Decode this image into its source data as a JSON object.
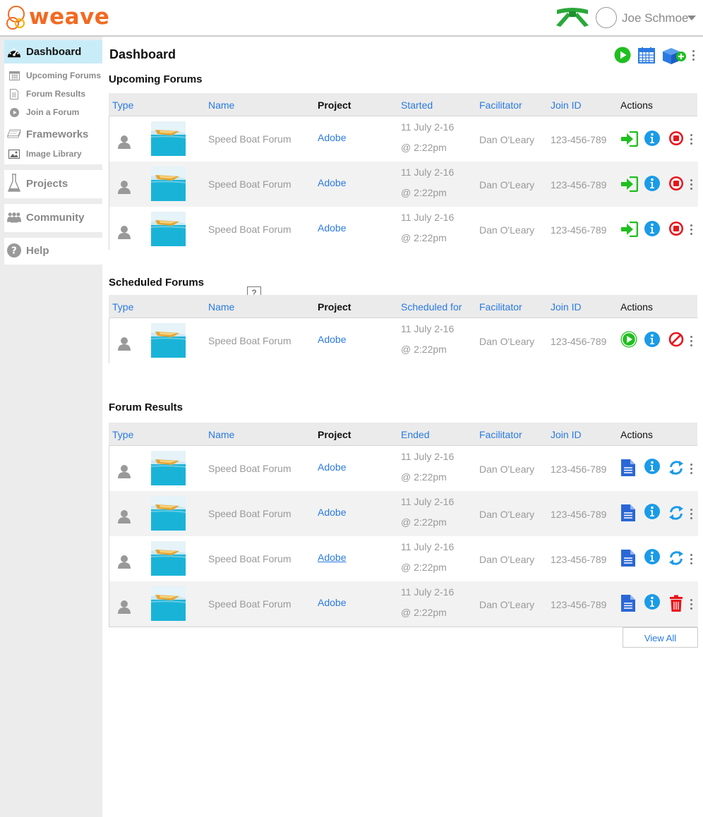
{
  "app": {
    "logo_text": "weave",
    "brand_color": "#f26a21"
  },
  "user": {
    "name": "Joe Schmoe",
    "belt_icon": "green-belt-icon"
  },
  "sidebar": {
    "items": [
      {
        "label": "Dashboard",
        "icon": "dashboard-gauge-icon",
        "active": true
      },
      {
        "label": "Upcoming Forums",
        "icon": "calendar-icon"
      },
      {
        "label": "Forum Results",
        "icon": "document-icon"
      },
      {
        "label": "Join a Forum",
        "icon": "play-circle-icon"
      },
      {
        "label": "Frameworks",
        "icon": "stack-icon"
      },
      {
        "label": "Image Library",
        "icon": "image-icon"
      },
      {
        "label": "Projects",
        "icon": "flask-icon"
      },
      {
        "label": "Community",
        "icon": "people-icon"
      },
      {
        "label": "Help",
        "icon": "question-circle-icon"
      }
    ]
  },
  "main": {
    "title": "Dashboard",
    "top_actions": [
      "play-circle-icon",
      "calendar-icon",
      "new-box-icon"
    ]
  },
  "upcoming": {
    "title": "Upcoming Forums",
    "columns": [
      "Type",
      "Name",
      "Project",
      "Started",
      "Facilitator",
      "Join ID",
      "Actions"
    ],
    "rows": [
      {
        "name": "Speed Boat Forum",
        "project": "Adobe",
        "date_line1": "11 July 2-16",
        "date_line2": "@ 2:22pm",
        "facilitator": "Dan O'Leary",
        "join_id": "123-456-789"
      },
      {
        "name": "Speed Boat Forum",
        "project": "Adobe",
        "date_line1": "11 July 2-16",
        "date_line2": "@ 2:22pm",
        "facilitator": "Dan O'Leary",
        "join_id": "123-456-789"
      },
      {
        "name": "Speed Boat Forum",
        "project": "Adobe",
        "date_line1": "11 July 2-16",
        "date_line2": "@ 2:22pm",
        "facilitator": "Dan O'Leary",
        "join_id": "123-456-789"
      }
    ]
  },
  "scheduled": {
    "title": "Scheduled Forums",
    "help_glyph": "?",
    "columns": [
      "Type",
      "Name",
      "Project",
      "Scheduled for",
      "Facilitator",
      "Join ID",
      "Actions"
    ],
    "rows": [
      {
        "name": "Speed Boat Forum",
        "project": "Adobe",
        "date_line1": "11 July 2-16",
        "date_line2": "@ 2:22pm",
        "facilitator": "Dan O'Leary",
        "join_id": "123-456-789"
      }
    ]
  },
  "results": {
    "title": "Forum Results",
    "columns": [
      "Type",
      "Name",
      "Project",
      "Ended",
      "Facilitator",
      "Join ID",
      "Actions"
    ],
    "rows": [
      {
        "name": "Speed Boat Forum",
        "project": "Adobe",
        "date_line1": "11 July 2-16",
        "date_line2": "@ 2:22pm",
        "facilitator": "Dan O'Leary",
        "join_id": "123-456-789",
        "third_action": "refresh"
      },
      {
        "name": "Speed Boat Forum",
        "project": "Adobe",
        "date_line1": "11 July 2-16",
        "date_line2": "@ 2:22pm",
        "facilitator": "Dan O'Leary",
        "join_id": "123-456-789",
        "third_action": "refresh"
      },
      {
        "name": "Speed Boat Forum",
        "project": "Adobe",
        "date_line1": "11 July 2-16",
        "date_line2": "@ 2:22pm",
        "facilitator": "Dan O'Leary",
        "join_id": "123-456-789",
        "third_action": "refresh"
      },
      {
        "name": "Speed Boat Forum",
        "project": "Adobe",
        "date_line1": "11 July 2-16",
        "date_line2": "@ 2:22pm",
        "facilitator": "Dan O'Leary",
        "join_id": "123-456-789",
        "third_action": "delete"
      }
    ],
    "view_all_label": "View All"
  },
  "colors": {
    "link": "#2a7ae2",
    "green": "#1fbf1f",
    "info": "#1a9be8",
    "red": "#e8141b",
    "active_nav": "#c9ecf9"
  }
}
